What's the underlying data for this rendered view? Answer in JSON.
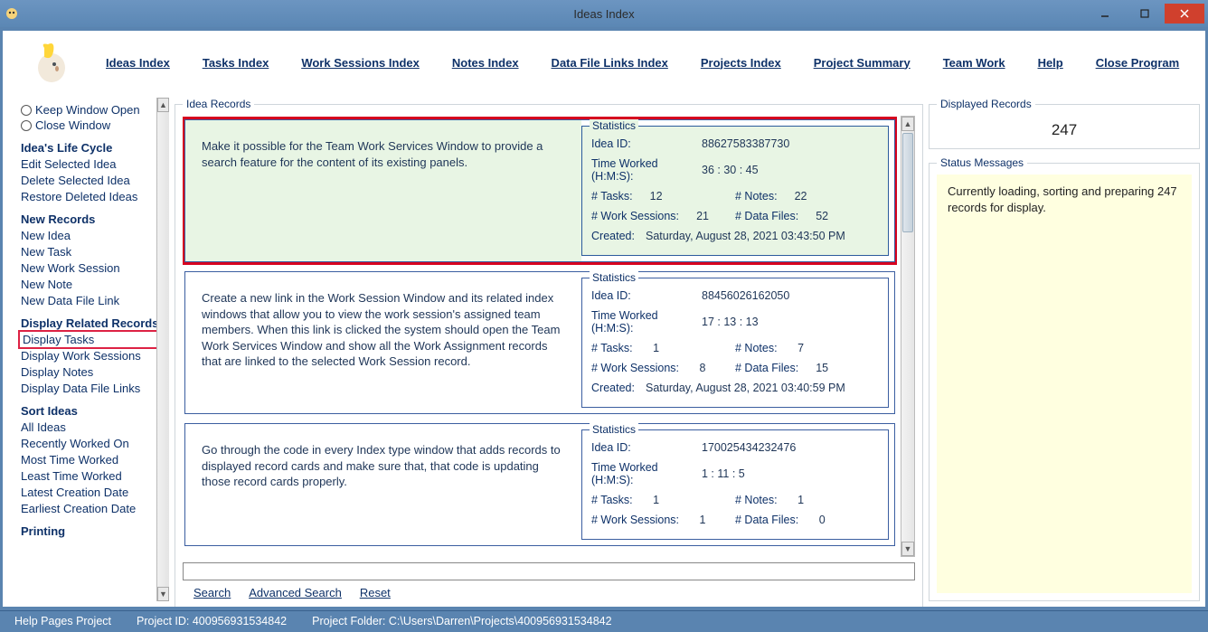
{
  "window": {
    "title": "Ideas Index"
  },
  "menubar": {
    "items": [
      {
        "label": "Ideas Index",
        "u": 0
      },
      {
        "label": "Tasks Index",
        "u": 0
      },
      {
        "label": "Work Sessions Index",
        "u": 0
      },
      {
        "label": "Notes Index",
        "u": 0
      },
      {
        "label": "Data File Links Index",
        "u": 0
      },
      {
        "label": "Projects Index",
        "u": 0
      },
      {
        "label": "Project Summary",
        "u": 0
      },
      {
        "label": "Team Work",
        "u": -1
      },
      {
        "label": "Help",
        "u": 0
      },
      {
        "label": "Close Program",
        "u": 0
      }
    ]
  },
  "sidebar": {
    "keep_open": "Keep Window Open",
    "close_window": "Close Window",
    "sections": {
      "lifecycle": {
        "heading": "Idea's Life Cycle",
        "items": [
          "Edit Selected Idea",
          "Delete Selected Idea",
          "Restore Deleted Ideas"
        ]
      },
      "newrec": {
        "heading": "New Records",
        "items": [
          "New Idea",
          "New Task",
          "New Work Session",
          "New Note",
          "New Data File Link"
        ]
      },
      "related": {
        "heading": "Display Related Records",
        "items": [
          "Display Tasks",
          "Display Work Sessions",
          "Display Notes",
          "Display Data File Links"
        ]
      },
      "sort": {
        "heading": "Sort Ideas",
        "items": [
          "All Ideas",
          "Recently Worked On",
          "Most Time Worked",
          "Least Time Worked",
          "Latest Creation Date",
          "Earliest Creation Date"
        ]
      },
      "printing": {
        "heading": "Printing"
      }
    }
  },
  "records_group_title": "Idea Records",
  "ideas": [
    {
      "selected": true,
      "text": "Make it possible for the Team Work Services Window to provide a search feature for the content of its existing panels.",
      "stats": {
        "id": "88627583387730",
        "time_worked": "36  :  30  :  45",
        "tasks": "12",
        "notes": "22",
        "work_sessions": "21",
        "data_files": "52",
        "created": "Saturday, August 28, 2021   03:43:50 PM"
      }
    },
    {
      "selected": false,
      "text": "Create a new link in the Work Session Window and its related index windows that allow you to view the work session's assigned team members. When this link is clicked the system should open the Team Work Services Window and show all the Work Assignment records that are linked to the selected Work Session record.",
      "stats": {
        "id": "88456026162050",
        "time_worked": "17  :  13  :  13",
        "tasks": "1",
        "notes": "7",
        "work_sessions": "8",
        "data_files": "15",
        "created": "Saturday, August 28, 2021   03:40:59 PM"
      }
    },
    {
      "selected": false,
      "text": "Go through the code in every Index type window that adds records to displayed record cards and make sure that, that code is updating those record cards properly.",
      "stats": {
        "id": "170025434232476",
        "time_worked": "1  :  11  :   5",
        "tasks": "1",
        "notes": "1",
        "work_sessions": "1",
        "data_files": "0",
        "created": ""
      }
    }
  ],
  "stats_labels": {
    "title": "Statistics",
    "id": "Idea ID:",
    "time": "Time Worked (H:M:S):",
    "tasks": "# Tasks:",
    "notes": "# Notes:",
    "ws": "# Work Sessions:",
    "df": "# Data Files:",
    "created": "Created:"
  },
  "search": {
    "value": "",
    "links": {
      "search": "Search",
      "advanced": "Advanced Search",
      "reset": "Reset"
    }
  },
  "right": {
    "displayed_title": "Displayed Records",
    "displayed_count": "247",
    "status_title": "Status Messages",
    "status_text": "Currently loading, sorting and preparing 247 records for display."
  },
  "footer": {
    "a": "Help Pages Project",
    "b": "Project ID:  400956931534842",
    "c": "Project Folder:  C:\\Users\\Darren\\Projects\\400956931534842"
  }
}
